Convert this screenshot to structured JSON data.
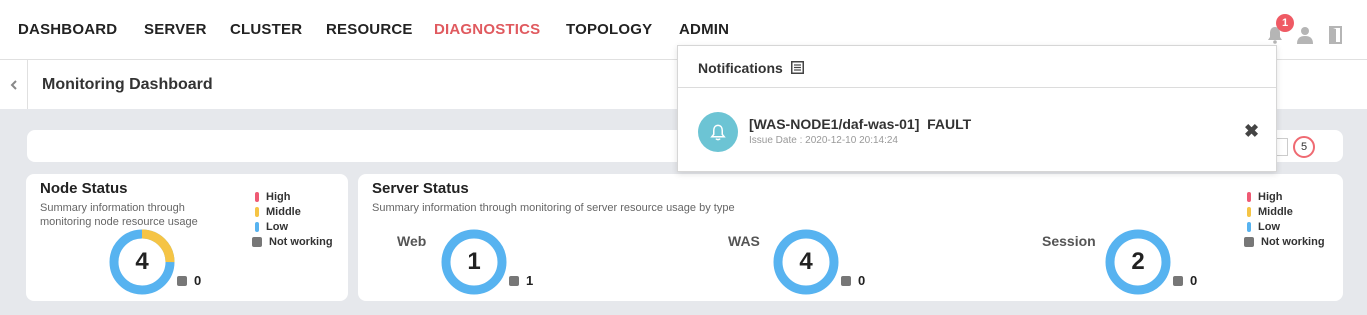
{
  "nav": {
    "items": [
      {
        "label": "DASHBOARD",
        "active": false
      },
      {
        "label": "SERVER",
        "active": false
      },
      {
        "label": "CLUSTER",
        "active": false
      },
      {
        "label": "RESOURCE",
        "active": false
      },
      {
        "label": "DIAGNOSTICS",
        "active": true
      },
      {
        "label": "TOPOLOGY",
        "active": false
      },
      {
        "label": "ADMIN",
        "active": false
      }
    ],
    "notification_badge": "1",
    "icons": [
      "bell-icon",
      "user-icon",
      "logout-icon"
    ]
  },
  "page": {
    "title": "Monitoring Dashboard",
    "collapse_icon": "chevron-left-icon",
    "refresh_count": "5"
  },
  "legend": {
    "high": "High",
    "middle": "Middle",
    "low": "Low",
    "not_working": "Not working"
  },
  "node_status": {
    "title": "Node Status",
    "description": "Summary information through monitoring node resource usage",
    "total": "4",
    "not_working": "0",
    "ring": {
      "low_fraction": 0.75,
      "middle_fraction": 0.25
    }
  },
  "server_status": {
    "title": "Server Status",
    "description": "Summary information through monitoring of server resource usage by type",
    "types": [
      {
        "label": "Web",
        "total": "1",
        "not_working": "1"
      },
      {
        "label": "WAS",
        "total": "4",
        "not_working": "0"
      },
      {
        "label": "Session",
        "total": "2",
        "not_working": "0"
      }
    ]
  },
  "notifications": {
    "title": "Notifications",
    "items": [
      {
        "message": "[WAS-NODE1/daf-was-01]  FAULT",
        "date": "Issue Date : 2020-12-10 20:14:24"
      }
    ]
  },
  "colors": {
    "active_nav": "#e05a5f",
    "high": "#ef5a74",
    "middle": "#f5c445",
    "low": "#57b3f0",
    "not_working": "#777777",
    "badge": "#ef5a64",
    "notif_icon_bg": "#6cc4d4"
  }
}
